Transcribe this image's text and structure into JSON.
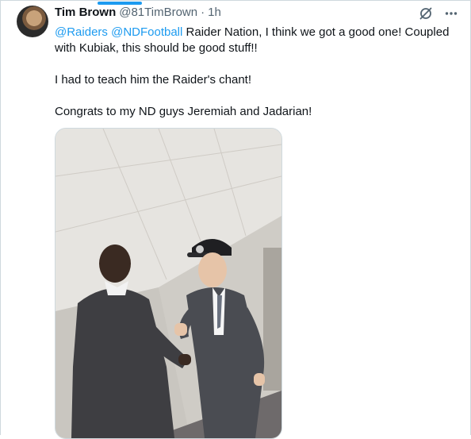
{
  "tweet": {
    "author_name": "Tim Brown",
    "author_handle": "@81TimBrown",
    "separator": "·",
    "time": "1h",
    "mention_1": "@Raiders",
    "mention_2": "@NDFootball",
    "line1_rest": " Raider Nation, I think we got a good one! Coupled with Kubiak, this should be good stuff!!",
    "paragraph_2": "I had to teach him the Raider's chant!",
    "paragraph_3": "Congrats to my ND guys Jeremiah  and Jadarian!"
  },
  "icons": {
    "grok": "grok-slash-icon",
    "more": "more-icon"
  },
  "colors": {
    "link": "#1d9bf0",
    "secondary_text": "#536471",
    "border": "#cfd9de"
  }
}
